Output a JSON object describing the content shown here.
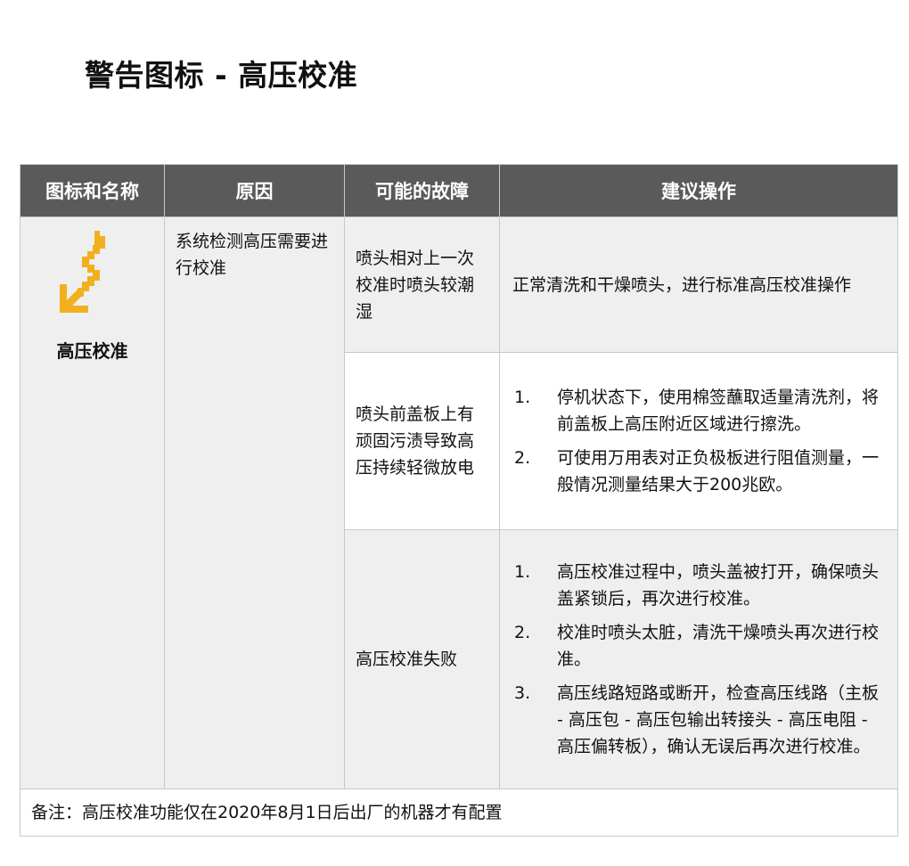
{
  "title": "警告图标 - 高压校准",
  "table": {
    "headers": [
      "图标和名称",
      "原因",
      "可能的故障",
      "建议操作"
    ],
    "icon": {
      "name": "high-voltage-warning-icon",
      "color": "#f2b01e"
    },
    "icon_name": "高压校准",
    "cause": "系统检测高压需要进行校准",
    "rows": [
      {
        "fault": "喷头相对上一次校准时喷头较潮湿",
        "action": "正常清洗和干燥喷头，进行标准高压校准操作"
      },
      {
        "fault": "喷头前盖板上有顽固污渍导致高压持续轻微放电",
        "steps": [
          {
            "num": "1.",
            "text": "停机状态下，使用棉签蘸取适量清洗剂，将前盖板上高压附近区域进行擦洗。"
          },
          {
            "num": "2.",
            "text": "可使用万用表对正负极板进行阻值测量，一般情况测量结果大于200兆欧。"
          }
        ]
      },
      {
        "fault": "高压校准失败",
        "steps": [
          {
            "num": "1.",
            "text": "高压校准过程中，喷头盖被打开，确保喷头盖紧锁后，再次进行校准。"
          },
          {
            "num": "2.",
            "text": "校准时喷头太脏，清洗干燥喷头再次进行校准。"
          },
          {
            "num": "3.",
            "text": "高压线路短路或断开，检查高压线路（主板 - 高压包 - 高压包输出转接头 - 高压电阻 - 高压偏转板），确认无误后再次进行校准。"
          }
        ]
      }
    ],
    "note": "备注：高压校准功能仅在2020年8月1日后出厂的机器才有配置"
  }
}
